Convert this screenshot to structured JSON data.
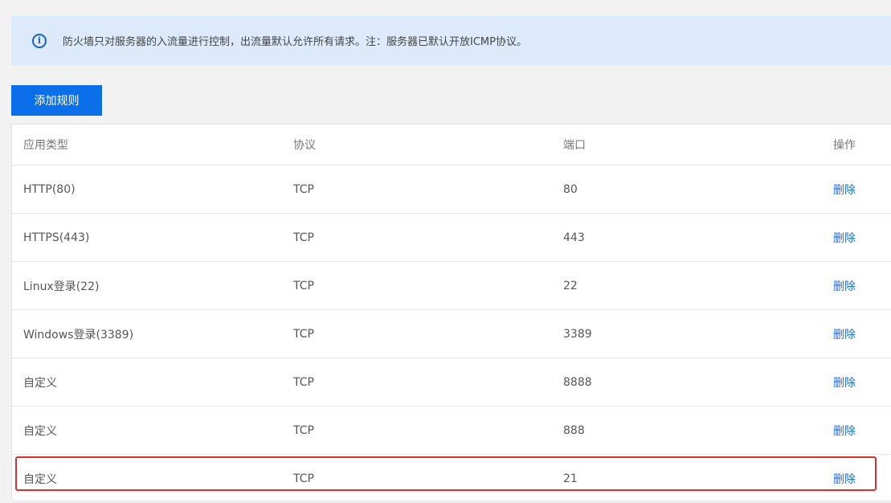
{
  "notice": {
    "icon": "info-icon",
    "text": "防火墙只对服务器的入流量进行控制，出流量默认允许所有请求。注：服务器已默认开放ICMP协议。"
  },
  "toolbar": {
    "add_rule_label": "添加规则",
    "accent_color": "#0a6fe8"
  },
  "table": {
    "columns": [
      "应用类型",
      "协议",
      "端口",
      "操作"
    ],
    "rows": [
      {
        "app_type": "HTTP(80)",
        "protocol": "TCP",
        "port": "80",
        "action": "删除"
      },
      {
        "app_type": "HTTPS(443)",
        "protocol": "TCP",
        "port": "443",
        "action": "删除"
      },
      {
        "app_type": "Linux登录(22)",
        "protocol": "TCP",
        "port": "22",
        "action": "删除"
      },
      {
        "app_type": "Windows登录(3389)",
        "protocol": "TCP",
        "port": "3389",
        "action": "删除"
      },
      {
        "app_type": "自定义",
        "protocol": "TCP",
        "port": "8888",
        "action": "删除"
      },
      {
        "app_type": "自定义",
        "protocol": "TCP",
        "port": "888",
        "action": "删除"
      },
      {
        "app_type": "自定义",
        "protocol": "TCP",
        "port": "21",
        "action": "删除"
      }
    ]
  },
  "highlight": {
    "row_index": 6,
    "color": "#d63030"
  }
}
